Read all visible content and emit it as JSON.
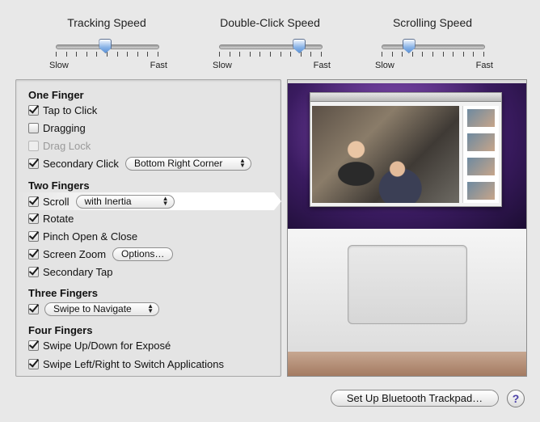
{
  "sliders": [
    {
      "title": "Tracking Speed",
      "min_label": "Slow",
      "max_label": "Fast",
      "value": 0.48
    },
    {
      "title": "Double-Click Speed",
      "min_label": "Slow",
      "max_label": "Fast",
      "value": 0.78
    },
    {
      "title": "Scrolling Speed",
      "min_label": "Slow",
      "max_label": "Fast",
      "value": 0.26
    }
  ],
  "one_finger": {
    "title": "One Finger",
    "tap_to_click": {
      "label": "Tap to Click",
      "checked": true
    },
    "dragging": {
      "label": "Dragging",
      "checked": false
    },
    "drag_lock": {
      "label": "Drag Lock",
      "checked": false,
      "disabled": true
    },
    "secondary_click": {
      "label": "Secondary Click",
      "checked": true,
      "popup": "Bottom Right Corner"
    }
  },
  "two_fingers": {
    "title": "Two Fingers",
    "scroll": {
      "label": "Scroll",
      "checked": true,
      "popup": "with Inertia"
    },
    "rotate": {
      "label": "Rotate",
      "checked": true
    },
    "pinch": {
      "label": "Pinch Open & Close",
      "checked": true
    },
    "screen_zoom": {
      "label": "Screen Zoom",
      "checked": true,
      "button": "Options…"
    },
    "secondary_tap": {
      "label": "Secondary Tap",
      "checked": true
    }
  },
  "three_fingers": {
    "title": "Three Fingers",
    "swipe": {
      "checked": true,
      "popup": "Swipe to Navigate"
    }
  },
  "four_fingers": {
    "title": "Four Fingers",
    "swipe_updown": {
      "label": "Swipe Up/Down for Exposé",
      "checked": true
    },
    "swipe_leftright": {
      "label": "Swipe Left/Right to Switch Applications",
      "checked": true
    }
  },
  "buttons": {
    "bluetooth": "Set Up Bluetooth Trackpad…",
    "help": "?"
  }
}
